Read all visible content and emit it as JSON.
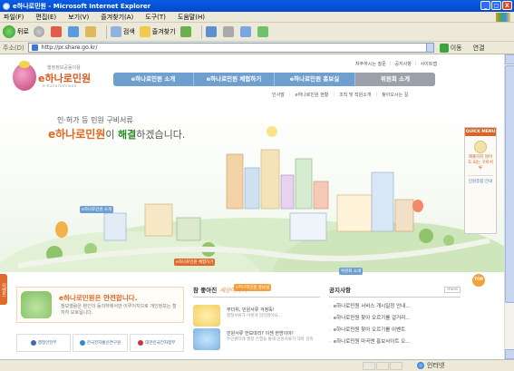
{
  "window": {
    "title": "e하나로민원 - Microsoft Internet Explorer",
    "controls": [
      "_",
      "□",
      "X"
    ]
  },
  "menu": [
    "파일(F)",
    "편집(E)",
    "보기(V)",
    "즐겨찾기(A)",
    "도구(T)",
    "도움말(H)"
  ],
  "toolbar": {
    "back": "뒤로",
    "search": "검색",
    "favorites": "즐겨찾기"
  },
  "address": {
    "label": "주소(D)",
    "url": "http://pr.share.go.kr/",
    "go": "이동",
    "links": "연결"
  },
  "site": {
    "logo": {
      "tagline": "행정정보공동이용",
      "name": "e하나로민원",
      "sub": "e-hanaromiwon"
    },
    "top_links": [
      "자주하시는 질문",
      "공지사항",
      "사이트맵"
    ],
    "gnb": [
      {
        "label": "e하나로민원 소개",
        "colored": true
      },
      {
        "label": "e하나로민원 체험하기",
        "colored": true
      },
      {
        "label": "e하나로민원 홍보실",
        "colored": true
      },
      {
        "label": "위원회 소개",
        "colored": false
      }
    ],
    "subnav": [
      "인사말",
      "e하나로민원 현황",
      "조직 및 직원소개",
      "찾아오시는 길"
    ],
    "hero": {
      "line1": "인·허가 등 민원 구비서류",
      "brand": "e하나로민원",
      "line2_mid": "이",
      "accent": "해결",
      "line2_end": "하겠습니다."
    },
    "scene_labels": {
      "intro": "e하나로민원 소개",
      "experience": "e하나로민원 체험하기",
      "committee": "위원회 소개",
      "pr": "e하나로민원 홍보실"
    },
    "quick_menu": {
      "title": "QUICK MENU",
      "item1": "제출하지 않아도 되는 구비서류",
      "item2": "민원종합 안내",
      "top": "TOP"
    },
    "side_tab": "이벤트",
    "injeung": {
      "title_brand": "e하나로민원",
      "title_mid": "은 ",
      "title_accent": "안전",
      "title_end": "합니다.",
      "desc": "정보열람은 본인의 동의하에서만 이루어지므로 개인정보는 철저히 보호됩니다."
    },
    "partners": [
      "행정안전부",
      "한국전자통신연구원",
      "대한민국전자정부"
    ],
    "sotry": {
      "title": "참 좋아진",
      "script": "세상이야기",
      "items": [
        {
          "title": "무더위, 민원서류 걱정뚝!",
          "desc": "행정서류가 이렇게 달라졌어요..."
        },
        {
          "title": "민원서류 한보따리? 이젠 한방이야!",
          "desc": "주민센터에 행정 은행을 통해 민원서류가 대폭 감축"
        }
      ]
    },
    "notice": {
      "title": "공지사항",
      "more": "more",
      "items": [
        "e하나로민원 서비스 개시일정 안내...",
        "e하나로민원 찾아 오르기를 걸거리...",
        "e하나로민원 찾아 오르기를 이벤트",
        "e하나로민원 마곡맨 홍보사이트 오..."
      ]
    }
  },
  "status": {
    "zone": "인터넷"
  },
  "colors": {
    "titlebar": "#0a5de5",
    "brand_orange": "#e3651e",
    "nav_blue": "#6f9fcf",
    "accent_green": "#2a8c2a"
  }
}
